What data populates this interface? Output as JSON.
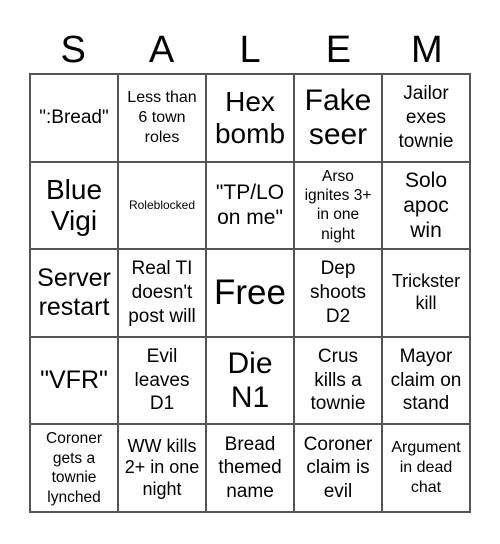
{
  "header": {
    "letters": [
      "S",
      "A",
      "L",
      "E",
      "M"
    ]
  },
  "cells": [
    [
      ":Bread\"",
      "Less than\n6 town\nroles",
      "Hex\nbomb",
      "Fake\nseer",
      "Jailor\nexes\ntownie"
    ],
    [
      "Blue\nVigi",
      "Roleblocked",
      "\"TP/LO\non me\"",
      "Arso\nignites 3+\nin one\nnight",
      "Solo\napoc\nwin"
    ],
    [
      "Server\nrestart",
      "Real TI\ndoesn't\npost will",
      "Free",
      "Dep\nshoots\nD2",
      "Trickster\nkill"
    ],
    [
      "\"VFR\"",
      "Evil\nleaves\nD1",
      "Die\nN1",
      "Crus\nkills a\ntownie",
      "Mayor\nclaim on\nstand"
    ],
    [
      "Coroner\ngets a\ntownie\nlynched",
      "WW kills\n2+ in one\nnight",
      "Bread\nthemed\nname",
      "Coroner\nclaim is\nevil",
      "Argument\nin dead\nchat"
    ]
  ],
  "first_cell_display": "\":Bread\""
}
